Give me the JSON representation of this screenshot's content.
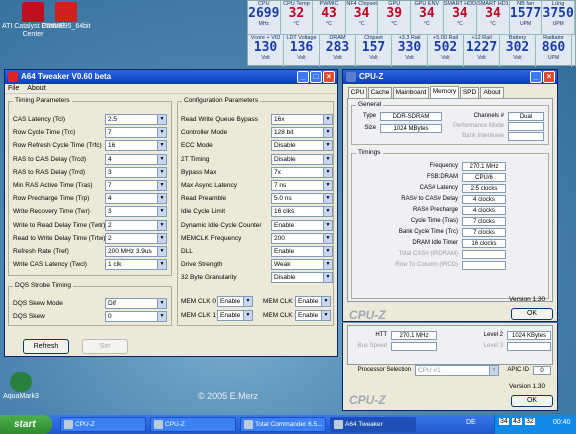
{
  "desktop": {
    "icons": [
      {
        "label": "ATI Catalyst Control Center"
      },
      {
        "label": "PRIME95_64bit"
      },
      {
        "label": "AquaMark3"
      }
    ],
    "watermark": "© 2005 E.Merz"
  },
  "monitor": {
    "row1": [
      {
        "label": "CPU",
        "value": "2699",
        "unit": "MHz"
      },
      {
        "label": "CPU Temp",
        "value": "32",
        "unit": "°C",
        "red": true
      },
      {
        "label": "PWMIC",
        "value": "43",
        "unit": "°C",
        "red": true
      },
      {
        "label": "NF4 Chipset",
        "value": "34",
        "unit": "°C",
        "red": true
      },
      {
        "label": "GPU",
        "value": "39",
        "unit": "°C",
        "red": true
      },
      {
        "label": "GPU ENV",
        "value": "34",
        "unit": "°C",
        "red": true
      },
      {
        "label": "SMART HDD",
        "value": "34",
        "unit": "°C",
        "red": true
      },
      {
        "label": "SMART HD1",
        "value": "34",
        "unit": "°C",
        "red": true
      },
      {
        "label": "NB fan",
        "value": "1577",
        "unit": "UPM"
      },
      {
        "label": "Lüng",
        "value": "3750",
        "unit": "UPM"
      }
    ],
    "row2": [
      {
        "label": "Vcore + VID",
        "value": "130",
        "unit": "Volt"
      },
      {
        "label": "LDT Voltage",
        "value": "136",
        "unit": "Volt"
      },
      {
        "label": "DRAM",
        "value": "283",
        "unit": "Volt"
      },
      {
        "label": "Chipset",
        "value": "157",
        "unit": "Volt"
      },
      {
        "label": "+3.3 Rail",
        "value": "330",
        "unit": "Volt"
      },
      {
        "label": "+5.00 Rail",
        "value": "502",
        "unit": "Volt"
      },
      {
        "label": "+12 Rail",
        "value": "1227",
        "unit": "Volt"
      },
      {
        "label": "Battery",
        "value": "302",
        "unit": "Volt"
      },
      {
        "label": "Radiator",
        "value": "860",
        "unit": "UPM"
      }
    ]
  },
  "a64": {
    "title": "A64 Tweaker V0.60 beta",
    "menu": [
      "File",
      "About"
    ],
    "timing_title": "Timing Parameters",
    "timing": [
      {
        "label": "CAS Latency (Tcl)",
        "value": "2.5"
      },
      {
        "label": "Row Cycle Time (Trc)",
        "value": "7"
      },
      {
        "label": "Row Refresh Cycle Time (Trfc)",
        "value": "16"
      },
      {
        "label": "RAS to CAS Delay (Trcd)",
        "value": "4"
      },
      {
        "label": "RAS to RAS Delay (Trrd)",
        "value": "3"
      },
      {
        "label": "Min RAS Active Time (Tras)",
        "value": "7"
      },
      {
        "label": "Row Precharge Time (Trp)",
        "value": "4"
      },
      {
        "label": "Write Recovery Time (Twr)",
        "value": "3"
      },
      {
        "label": "Write to Read Delay Time (Twtr)",
        "value": "2"
      },
      {
        "label": "Read to Write Delay Time (Trtw)",
        "value": "2"
      },
      {
        "label": "Refresh Rate (Tref)",
        "value": "200 MHz 3.9us"
      },
      {
        "label": "Write CAS Latency (Twcl)",
        "value": "1 clk"
      }
    ],
    "config_title": "Configuration Parameters",
    "config": [
      {
        "label": "Read Write Queue Bypass",
        "value": "16x"
      },
      {
        "label": "Controller Mode",
        "value": "128 bit"
      },
      {
        "label": "ECC Mode",
        "value": "Disable"
      },
      {
        "label": "2T Timing",
        "value": "Disable"
      },
      {
        "label": "Bypass Max",
        "value": "7x"
      },
      {
        "label": "Max Async Latency",
        "value": "7 ns"
      },
      {
        "label": "Read Preamble",
        "value": "5.0 ns"
      },
      {
        "label": "Idle Cycle Limit",
        "value": "16 clks"
      },
      {
        "label": "Dynamic Idle Cycle Counter",
        "value": "Enable"
      },
      {
        "label": "MEMCLK Frequency",
        "value": "200"
      },
      {
        "label": "DLL",
        "value": "Enable"
      },
      {
        "label": "Drive Strength",
        "value": "Weak"
      },
      {
        "label": "32 Byte Granularity",
        "value": "Disable"
      }
    ],
    "memclk": [
      {
        "label": "MEM CLK 0",
        "value": "Enable"
      },
      {
        "label": "MEM CLK 2",
        "value": "Enable"
      },
      {
        "label": "MEM CLK 1",
        "value": "Enable"
      },
      {
        "label": "MEM CLK 3",
        "value": "Enable"
      }
    ],
    "dqs_title": "DQS Strobe Timing",
    "dqs": [
      {
        "label": "DQS Skew Mode",
        "value": "Dif"
      },
      {
        "label": "DQS Skew",
        "value": "0"
      }
    ],
    "refresh": "Refresh",
    "set": "Set"
  },
  "cpuz": {
    "title": "CPU-Z",
    "tabs": [
      "CPU",
      "Cache",
      "Mainboard",
      "Memory",
      "SPD",
      "About"
    ],
    "general_title": "General",
    "type_label": "Type",
    "type_value": "DDR-SDRAM",
    "size_label": "Size",
    "size_value": "1024 MBytes",
    "channels_label": "Channels #",
    "channels_value": "Dual",
    "perf_label": "Performance Mode",
    "bank_label": "Bank Interleave",
    "timings_title": "Timings",
    "timings": [
      {
        "label": "Frequency",
        "value": "270.1 MHz"
      },
      {
        "label": "FSB:DRAM",
        "value": "CPU/6"
      },
      {
        "label": "CAS# Latency",
        "value": "2.5 clocks"
      },
      {
        "label": "RAS# to CAS# Delay",
        "value": "4 clocks"
      },
      {
        "label": "RAS# Precharge",
        "value": "4 clocks"
      },
      {
        "label": "Cycle Time (Tras)",
        "value": "7 clocks"
      },
      {
        "label": "Bank Cycle Time (Trc)",
        "value": "7 clocks"
      },
      {
        "label": "DRAM Idle Timer",
        "value": "16 clocks"
      }
    ],
    "total_cas": "Total CAS# (tRDRAM)",
    "row_to_col": "Row To Column (tRCD)",
    "version": "Version 1.30",
    "ok": "OK",
    "logo": "CPU-Z"
  },
  "cpuz2": {
    "htt_label": "HTT",
    "htt_value": "270.1 MHz",
    "bus_label": "Bus Speed",
    "level2_label": "Level 2",
    "level2_value": "1024 KBytes",
    "level3_label": "Level 3",
    "proc_sel_label": "Processor Selection",
    "proc_sel_value": "CPU #1",
    "apic_label": "APIC ID",
    "apic_value": "0",
    "version": "Version 1.30",
    "ok": "OK",
    "logo": "CPU-Z"
  },
  "taskbar": {
    "start": "start",
    "tasks": [
      "CPU-Z",
      "CPU-Z",
      "Total Commander 6.5...",
      "A64 Tweaker"
    ],
    "lang": "DE",
    "clock": "00:40",
    "tray_nums": [
      "34",
      "43",
      "32"
    ]
  }
}
